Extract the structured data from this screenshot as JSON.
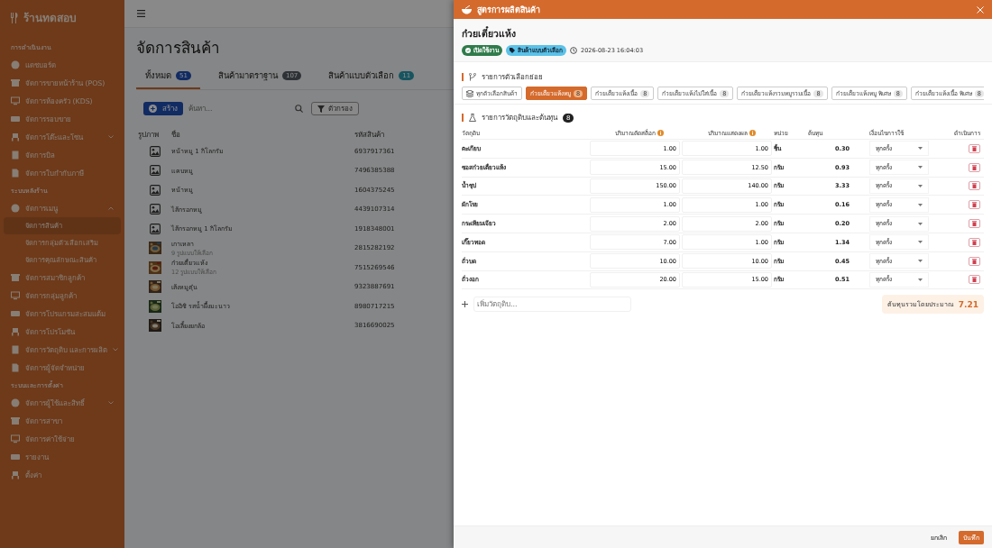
{
  "sidebar": {
    "brand": {
      "name": "ร้านทดสอบ"
    },
    "sections": [
      {
        "title": "การดำเนินงาน",
        "items": [
          {
            "label": "แดชบอร์ด",
            "selected": false
          },
          {
            "label": "จัดการขายหน้าร้าน (POS)",
            "selected": false
          },
          {
            "label": "จัดการห้องครัว (KDS)",
            "selected": false
          },
          {
            "label": "จัดการรอบขาย",
            "selected": false
          },
          {
            "label": "จัดการโต๊ะและโซน",
            "selected": false,
            "expanded": false
          },
          {
            "label": "จัดการบิล",
            "selected": false
          },
          {
            "label": "จัดการใบกำกับภาษี",
            "selected": false
          }
        ]
      },
      {
        "title": "ระบบหลังร้าน",
        "items": [
          {
            "label": "จัดการเมนู",
            "selected": false,
            "expanded": true,
            "children": [
              {
                "label": "จัดการสินค้า",
                "selected": true
              },
              {
                "label": "จัดการกลุ่มตัวเลือกเสริม",
                "selected": false
              },
              {
                "label": "จัดการคุณลักษณะสินค้า",
                "selected": false
              }
            ]
          },
          {
            "label": "จัดการสมาชิกลูกค้า",
            "selected": false
          },
          {
            "label": "จัดการกลุ่มลูกค้า",
            "selected": false
          },
          {
            "label": "จัดการโปรแกรมสะสมแต้ม",
            "selected": false
          },
          {
            "label": "จัดการโปรโมชัน",
            "selected": false
          },
          {
            "label": "จัดการวัตถุดิบ และการผลิต",
            "selected": false,
            "expanded": false
          },
          {
            "label": "จัดการผู้จัดจำหน่าย",
            "selected": false
          }
        ]
      },
      {
        "title": "ระบบและการตั้งค่า",
        "items": [
          {
            "label": "จัดการผู้ใช้และสิทธิ์",
            "selected": false,
            "expanded": false
          },
          {
            "label": "จัดการสาขา",
            "selected": false
          },
          {
            "label": "จัดการค่าใช้จ่าย",
            "selected": false
          },
          {
            "label": "รายงาน",
            "selected": false
          },
          {
            "label": "ตั้งค่า",
            "selected": false
          }
        ]
      }
    ]
  },
  "page": {
    "title": "จัดการสินค้า",
    "tabs": [
      {
        "label": "ทั้งหมด",
        "count": "51",
        "selected": true
      },
      {
        "label": "สินค้ามาตราฐาน",
        "count": "107",
        "selected": false
      },
      {
        "label": "สินค้าแบบตัวเลือก",
        "count": "11",
        "selected": false
      }
    ],
    "create_button": "สร้าง",
    "search": {
      "placeholder": "ค้นหา..."
    },
    "filter_button": "ตัวกรอง",
    "table": {
      "columns": [
        "รูปภาพ",
        "ชื่อ",
        "รหัสสินค้า"
      ],
      "rows": [
        {
          "kind": "placeholder",
          "name": "หน้าหมู 1 กิโลกรัม",
          "code": "6937917361"
        },
        {
          "kind": "placeholder",
          "name": "แคบหมู",
          "code": "7496385388"
        },
        {
          "kind": "placeholder",
          "name": "หน้าหมู",
          "code": "1604375245"
        },
        {
          "kind": "placeholder",
          "name": "ไส้กรอกหมู",
          "code": "4439107314"
        },
        {
          "kind": "placeholder",
          "name": "ไส้กรอกหมู 1 กิโลกรัม",
          "code": "1918348001"
        },
        {
          "kind": "picture",
          "name": "เกาเหลา",
          "note": "9 รูปแบบให้เลือก",
          "code": "2815282192"
        },
        {
          "kind": "picture",
          "name": "ก๋วยเตี๋ยวแห้ง",
          "note": "12 รูปแบบให้เลือก",
          "code": "7515269546"
        },
        {
          "kind": "picture",
          "name": "เส้งหมูตุ๋น",
          "code": "9323887691"
        },
        {
          "kind": "picture",
          "name": "โออิชิ รสน้ำผึ้งมะนาว",
          "code": "8980717215"
        },
        {
          "kind": "picture",
          "name": "โอเลี้ยงยกล้อ",
          "code": "3816690025"
        }
      ]
    }
  },
  "drawer": {
    "title": "สูตรการผลิตสินค้า",
    "product": "ก๋วยเตี๋ยวแห้ง",
    "badges": [
      {
        "label": "เปิดใช้งาน",
        "kind": "status"
      },
      {
        "label": "สินค้าแบบตัวเลือก",
        "kind": "type"
      }
    ],
    "timestamp": "2026-08-23 16:04:03",
    "variants": {
      "title": "รายการตัวเลือกย่อย",
      "chips": [
        {
          "kind": "all",
          "label": "ทุกตัวเลือกสินค้า",
          "selected": false
        },
        {
          "kind": "variant",
          "label": "ก๋วยเตี๋ยวแห้งหมู",
          "count": "8",
          "selected": true
        },
        {
          "kind": "variant",
          "label": "ก๋วยเตี๋ยวแห้งเนื้อ",
          "count": "8",
          "selected": false
        },
        {
          "kind": "variant",
          "label": "ก๋วยเตี๋ยวแห้งไม่ใส่เนื้อ",
          "count": "8",
          "selected": false
        },
        {
          "kind": "variant",
          "label": "ก๋วยเตี๋ยวแห้งรวมหมูรวมเนื้อ",
          "count": "8",
          "selected": false
        },
        {
          "kind": "variant",
          "label": "ก๋วยเตี๋ยวแห้งหมู พิเศษ",
          "count": "8",
          "selected": false
        },
        {
          "kind": "variant",
          "label": "ก๋วยเตี๋ยวแห้งเนื้อ พิเศษ",
          "count": "8",
          "selected": false
        }
      ]
    },
    "ingredients": {
      "title": "รายการวัตถุดิบและต้นทุน",
      "count": "8",
      "columns": [
        {
          "label": "วัตถุดิบ",
          "info": false
        },
        {
          "label": "ปริมาณตัดสต็อก",
          "info": true
        },
        {
          "label": "ปริมาณแสดงผล",
          "info": true
        },
        {
          "label": "หน่วย",
          "info": false
        },
        {
          "label": "ต้นทุน",
          "info": false
        },
        {
          "label": "เงื่อนไขการใช้",
          "info": false
        },
        {
          "label": "ดำเนินการ",
          "info": false
        }
      ],
      "rows": [
        {
          "name": "ตะเกียบ",
          "stock_qty": "1.00",
          "display_qty": "1.00",
          "unit": "ชิ้น",
          "cost": "0.30",
          "condition": "ทุกครั้ง"
        },
        {
          "name": "ซอสก๋วยเตี๋ยวแห้ง",
          "stock_qty": "15.00",
          "display_qty": "12.50",
          "unit": "กรัม",
          "cost": "0.93",
          "condition": "ทุกครั้ง"
        },
        {
          "name": "น้ำซุป",
          "stock_qty": "150.00",
          "display_qty": "140.00",
          "unit": "กรัม",
          "cost": "3.33",
          "condition": "ทุกครั้ง"
        },
        {
          "name": "ผักโรย",
          "stock_qty": "1.00",
          "display_qty": "1.00",
          "unit": "กรัม",
          "cost": "0.16",
          "condition": "ทุกครั้ง"
        },
        {
          "name": "กระเทียมเจียว",
          "stock_qty": "2.00",
          "display_qty": "2.00",
          "unit": "กรัม",
          "cost": "0.20",
          "condition": "ทุกครั้ง"
        },
        {
          "name": "เกี๊ยวทอด",
          "stock_qty": "7.00",
          "display_qty": "1.00",
          "unit": "กรัม",
          "cost": "1.34",
          "condition": "ทุกครั้ง"
        },
        {
          "name": "ถั่วบด",
          "stock_qty": "10.00",
          "display_qty": "10.00",
          "unit": "กรัม",
          "cost": "0.45",
          "condition": "ทุกครั้ง"
        },
        {
          "name": "ถั่วงอก",
          "stock_qty": "20.00",
          "display_qty": "15.00",
          "unit": "กรัม",
          "cost": "0.51",
          "condition": "ทุกครั้ง"
        }
      ],
      "add_placeholder": "เพิ่มวัตถุดิบ...",
      "total_label": "ต้นทุนรวมโดยประมาณ",
      "total": "7.21"
    },
    "buttons": [
      {
        "label": "ยกเลิก",
        "kind": "secondary"
      },
      {
        "label": "บันทึก",
        "kind": "primary"
      }
    ]
  }
}
